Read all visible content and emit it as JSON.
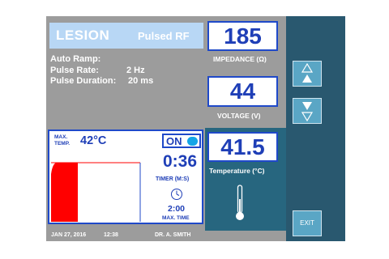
{
  "header": {
    "title": "LESION",
    "mode": "Pulsed RF"
  },
  "params": [
    {
      "label": "Auto Ramp:",
      "value": ""
    },
    {
      "label": "Pulse Rate:",
      "value": "2 Hz"
    },
    {
      "label": "Pulse Duration:",
      "value": "20 ms"
    }
  ],
  "impedance": {
    "value": "185",
    "label": "IMPEDANCE (Ω)"
  },
  "voltage": {
    "value": "44",
    "label": "VOLTAGE (V)"
  },
  "temperature": {
    "value": "41.5",
    "label": "Temperature (°C)"
  },
  "lesion_panel": {
    "max_temp_label_line1": "MAX.",
    "max_temp_label_line2": "TEMP.",
    "max_temp_value": "42°C",
    "on_label": "ON",
    "timer_value": "0:36",
    "timer_label": "TIMER (M:S)",
    "max_time_value": "2:00",
    "max_time_label": "MAX. TIME",
    "elapsed_fraction": 0.3
  },
  "buttons": {
    "up_icon": "triangle-up-icon",
    "down_icon": "triangle-down-icon",
    "exit_label": "EXIT"
  },
  "footer": {
    "date": "JAN 27, 2016",
    "time": "12:38",
    "user": "DR. A. SMITH"
  },
  "colors": {
    "panel_gray": "#9c9c9c",
    "side_panel": "#29586f",
    "accent_blue": "#1f49c9",
    "button": "#5aa6c5",
    "fill_red": "#ff0000",
    "on_light": "#13a5e7"
  }
}
